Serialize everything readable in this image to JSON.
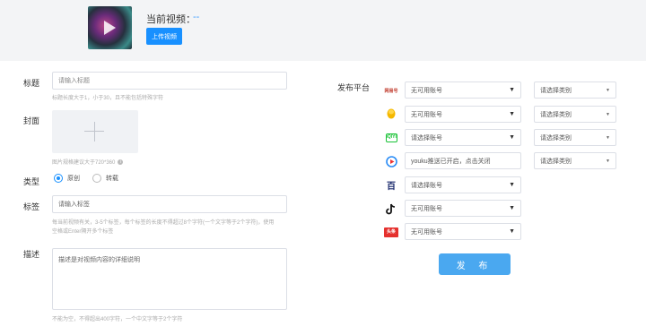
{
  "header": {
    "current_video_label": "当前视频：",
    "current_video_value": "--",
    "upload_button": "上传视频"
  },
  "form": {
    "title_label": "标题",
    "title_placeholder": "请输入标题",
    "title_hint": "标题长度大于1，小于30，且不能包括特殊字符",
    "cover_label": "封面",
    "cover_hint": "图片规格建议大于720*360",
    "type_label": "类型",
    "type_options": [
      "原创",
      "转载"
    ],
    "tags_label": "标签",
    "tags_placeholder": "请输入标签",
    "tags_hint_line1": "每当前视频有关，3-5个标签，每个标签的长度不得超过8个字符(一个文字等于2个字符)，使用",
    "tags_hint_line2": "空格或Enter隔开多个标签",
    "desc_label": "描述",
    "desc_placeholder": "描述是对视频内容的详细说明",
    "desc_hint": "不能为空，不得超出400字符，一个中文字等于2个字符"
  },
  "platforms": {
    "label": "发布平台",
    "rows": [
      {
        "icon": "netease-icon",
        "icon_text": "网易号",
        "icon_color": "#c0392b",
        "account": "无可用账号",
        "category": "请选择类别"
      },
      {
        "icon": "qq-icon",
        "icon_text": "",
        "icon_color": "#f5b800",
        "account": "无可用账号",
        "category": "请选择类别"
      },
      {
        "icon": "iqiyi-icon",
        "icon_text": "iQIYI",
        "icon_color": "#19c236",
        "account": "请选择账号",
        "category": "请选择类别"
      },
      {
        "icon": "youku-icon",
        "icon_text": "",
        "icon_color": "#2a8cf5",
        "account": "youku推送已开启，点击关闭",
        "category": "请选择类别"
      },
      {
        "icon": "baidu-icon",
        "icon_text": "百",
        "icon_color": "#1a2a6c",
        "account": "请选择账号",
        "category": ""
      },
      {
        "icon": "douyin-icon",
        "icon_text": "",
        "icon_color": "#111111",
        "account": "无可用账号",
        "category": ""
      },
      {
        "icon": "toutiao-icon",
        "icon_text": "头条",
        "icon_color": "#e5312e",
        "account": "无可用账号",
        "category": ""
      }
    ],
    "publish_button": "发 布"
  },
  "colors": {
    "accent": "#1890ff",
    "publish": "#4aa8f0",
    "header_bg": "#f3f4f6"
  }
}
